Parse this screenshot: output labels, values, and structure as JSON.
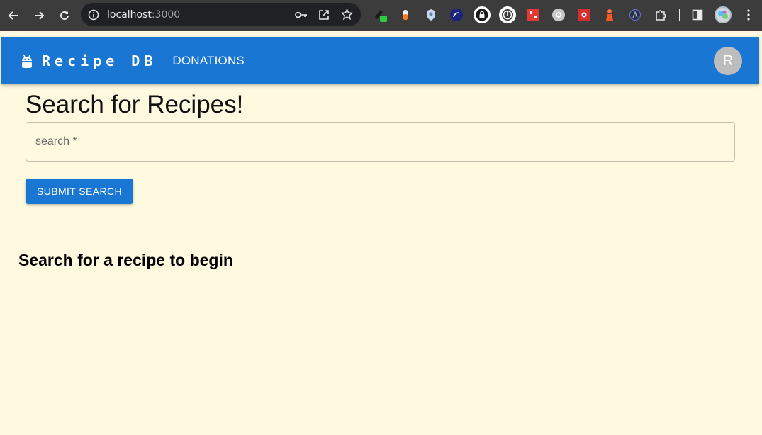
{
  "browser": {
    "url_host": "localhost",
    "url_port": ":3000"
  },
  "appbar": {
    "brand": "Recipe DB",
    "nav_donations": "DONATIONS",
    "avatar_initial": "R",
    "color": "#1976d2"
  },
  "main": {
    "title": "Search for Recipes!",
    "search_placeholder": "search *",
    "submit_label": "SUBMIT SEARCH",
    "empty_message": "Search for a recipe to begin"
  }
}
